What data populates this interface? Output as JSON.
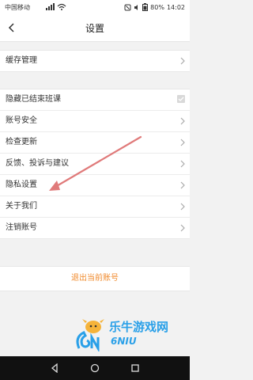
{
  "status_bar": {
    "carrier": "中国移动",
    "battery": "80%",
    "time": "14:02"
  },
  "nav": {
    "title": "设置"
  },
  "group1": {
    "items": [
      {
        "label": "缓存管理"
      }
    ]
  },
  "group2": {
    "items": [
      {
        "label": "隐藏已结束班课",
        "control": "checkbox",
        "checked": true
      },
      {
        "label": "账号安全"
      },
      {
        "label": "检查更新"
      },
      {
        "label": "反馈、投诉与建议"
      },
      {
        "label": "隐私设置"
      },
      {
        "label": "关于我们"
      },
      {
        "label": "注销账号"
      }
    ]
  },
  "logout_label": "退出当前账号",
  "watermark": {
    "text": "乐牛游戏网",
    "logo": "6NIU"
  },
  "colors": {
    "accent": "#f08a2c",
    "arrow": "#e07a7a",
    "watermark_blue": "#2aa0e8"
  }
}
